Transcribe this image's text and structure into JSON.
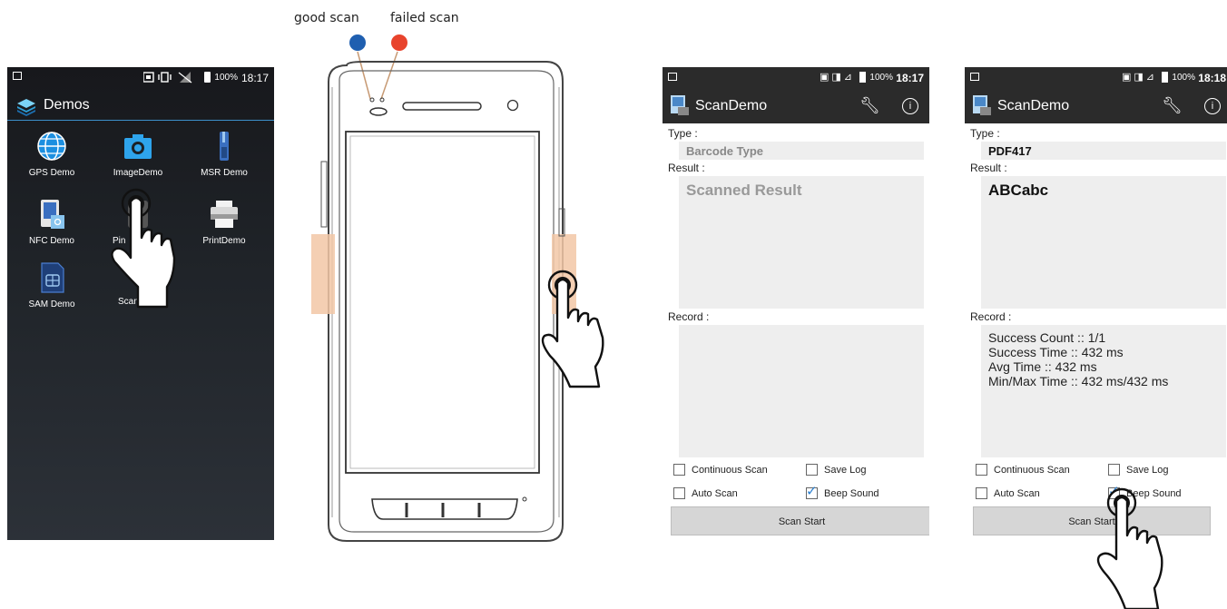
{
  "launcher": {
    "status": {
      "battery": "100%",
      "time": "18:17"
    },
    "title": "Demos",
    "apps": [
      {
        "label": "GPS Demo",
        "icon": "globe-icon"
      },
      {
        "label": "ImageDemo",
        "icon": "camera-icon"
      },
      {
        "label": "MSR Demo",
        "icon": "card-reader-icon"
      },
      {
        "label": "NFC Demo",
        "icon": "nfc-icon"
      },
      {
        "label": "Pin",
        "icon": "pin-pad-icon"
      },
      {
        "label": "PrintDemo",
        "icon": "printer-icon"
      },
      {
        "label": "SAM Demo",
        "icon": "sam-card-icon"
      },
      {
        "label": "ScanDemo",
        "icon": "scanner-icon"
      }
    ]
  },
  "device": {
    "good_label": "good scan",
    "failed_label": "failed scan",
    "good_color": "#1f5fb0",
    "failed_color": "#e8432c",
    "scan_key_color": "#f2c7a6"
  },
  "scan_before": {
    "status": {
      "battery": "100%",
      "time": "18:17"
    },
    "title": "ScanDemo",
    "type_label": "Type :",
    "type_value": "Barcode Type",
    "result_label": "Result :",
    "result_value": "Scanned Result",
    "record_label": "Record :",
    "record_lines": [],
    "options": {
      "continuous": {
        "label": "Continuous Scan",
        "checked": false
      },
      "save_log": {
        "label": "Save Log",
        "checked": false
      },
      "auto": {
        "label": "Auto Scan",
        "checked": false
      },
      "beep": {
        "label": "Beep Sound",
        "checked": true
      }
    },
    "button": "Scan Start"
  },
  "scan_after": {
    "status": {
      "battery": "100%",
      "time": "18:18"
    },
    "title": "ScanDemo",
    "type_label": "Type :",
    "type_value": "PDF417",
    "result_label": "Result :",
    "result_value": "ABCabc",
    "record_label": "Record :",
    "record_lines": [
      "Success Count :: 1/1",
      "Success Time :: 432 ms",
      "Avg Time :: 432 ms",
      "Min/Max Time :: 432 ms/432 ms"
    ],
    "options": {
      "continuous": {
        "label": "Continuous Scan",
        "checked": false
      },
      "save_log": {
        "label": "Save Log",
        "checked": false
      },
      "auto": {
        "label": "Auto Scan",
        "checked": false
      },
      "beep": {
        "label": "Beep Sound",
        "checked": true
      }
    },
    "button": "Scan Start",
    "button_visible": "Scan Start"
  }
}
